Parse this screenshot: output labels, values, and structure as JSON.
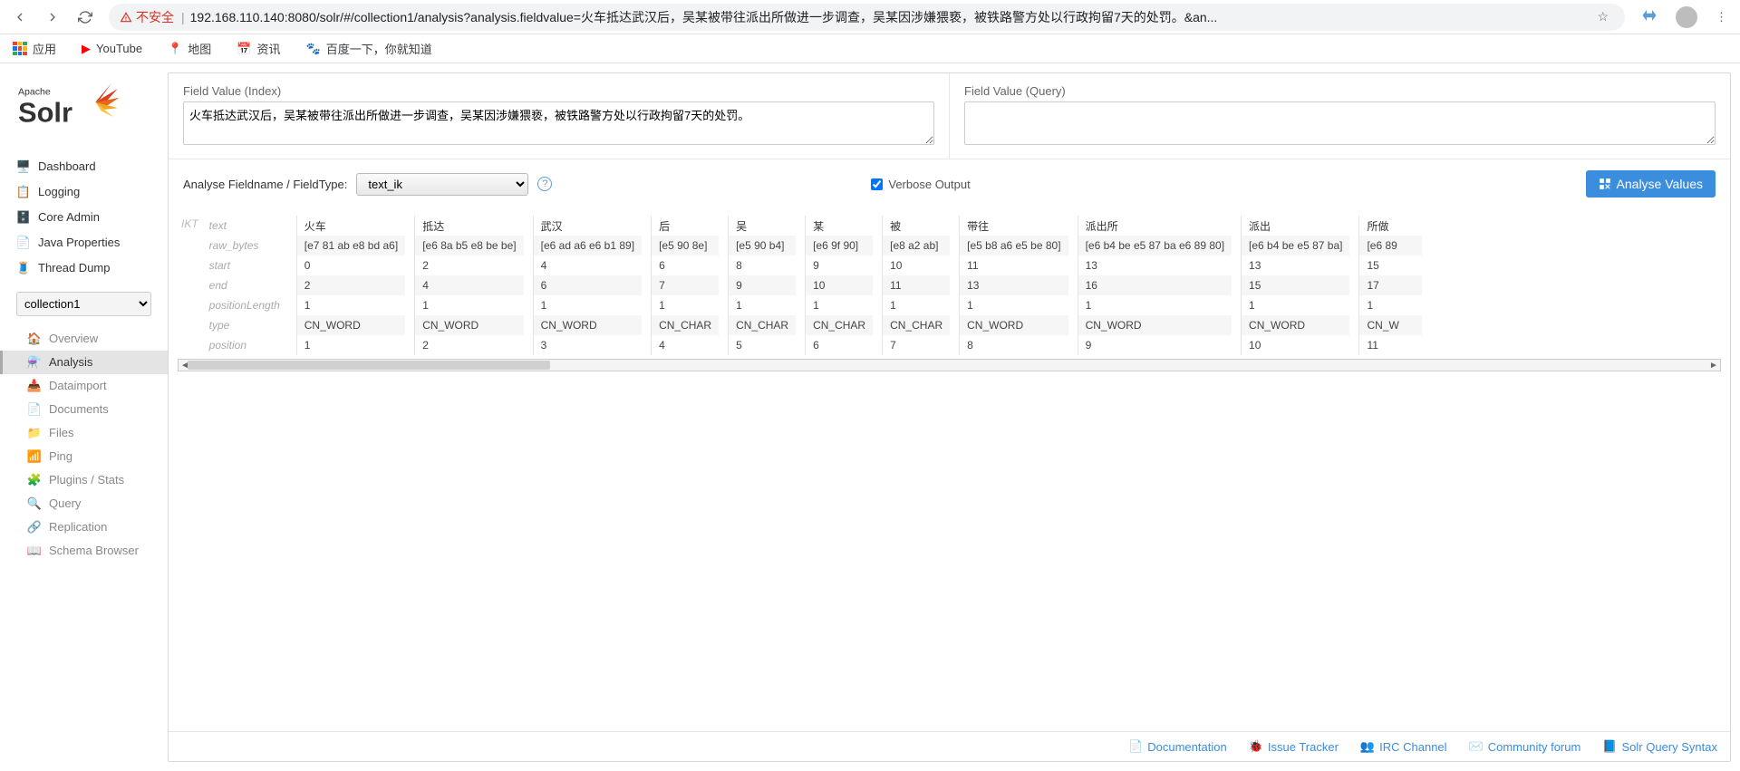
{
  "browser": {
    "insecure_label": "不安全",
    "url": "192.168.110.140:8080/solr/#/collection1/analysis?analysis.fieldvalue=火车抵达武汉后，吴某被带往派出所做进一步调查，吴某因涉嫌猥亵，被铁路警方处以行政拘留7天的处罚。&an..."
  },
  "bookmarks": {
    "apps": "应用",
    "items": [
      "YouTube",
      "地图",
      "资讯",
      "百度一下，你就知道"
    ]
  },
  "sidebar": {
    "logo_top": "Apache",
    "logo_main": "Solr",
    "items": [
      "Dashboard",
      "Logging",
      "Core Admin",
      "Java Properties",
      "Thread Dump"
    ],
    "collection_selected": "collection1",
    "sub": [
      "Overview",
      "Analysis",
      "Dataimport",
      "Documents",
      "Files",
      "Ping",
      "Plugins / Stats",
      "Query",
      "Replication",
      "Schema Browser"
    ]
  },
  "form": {
    "index_label": "Field Value (Index)",
    "index_value": "火车抵达武汉后，吴某被带往派出所做进一步调查，吴某因涉嫌猥亵，被铁路警方处以行政拘留7天的处罚。",
    "query_label": "Field Value (Query)",
    "query_value": "",
    "analyse_label": "Analyse Fieldname / FieldType:",
    "fieldtype_value": "text_ik",
    "verbose_label": "Verbose Output",
    "analyse_btn": "Analyse Values"
  },
  "analysis": {
    "tokenizer_label": "IKT",
    "row_labels": [
      "text",
      "raw_bytes",
      "start",
      "end",
      "positionLength",
      "type",
      "position"
    ],
    "columns": [
      {
        "text": "火车",
        "raw_bytes": "[e7 81 ab e8 bd a6]",
        "start": "0",
        "end": "2",
        "positionLength": "1",
        "type": "CN_WORD",
        "position": "1"
      },
      {
        "text": "抵达",
        "raw_bytes": "[e6 8a b5 e8 be be]",
        "start": "2",
        "end": "4",
        "positionLength": "1",
        "type": "CN_WORD",
        "position": "2"
      },
      {
        "text": "武汉",
        "raw_bytes": "[e6 ad a6 e6 b1 89]",
        "start": "4",
        "end": "6",
        "positionLength": "1",
        "type": "CN_WORD",
        "position": "3"
      },
      {
        "text": "后",
        "raw_bytes": "[e5 90 8e]",
        "start": "6",
        "end": "7",
        "positionLength": "1",
        "type": "CN_CHAR",
        "position": "4"
      },
      {
        "text": "吴",
        "raw_bytes": "[e5 90 b4]",
        "start": "8",
        "end": "9",
        "positionLength": "1",
        "type": "CN_CHAR",
        "position": "5"
      },
      {
        "text": "某",
        "raw_bytes": "[e6 9f 90]",
        "start": "9",
        "end": "10",
        "positionLength": "1",
        "type": "CN_CHAR",
        "position": "6"
      },
      {
        "text": "被",
        "raw_bytes": "[e8 a2 ab]",
        "start": "10",
        "end": "11",
        "positionLength": "1",
        "type": "CN_CHAR",
        "position": "7"
      },
      {
        "text": "带往",
        "raw_bytes": "[e5 b8 a6 e5 be 80]",
        "start": "11",
        "end": "13",
        "positionLength": "1",
        "type": "CN_WORD",
        "position": "8"
      },
      {
        "text": "派出所",
        "raw_bytes": "[e6 b4 be e5 87 ba e6 89 80]",
        "start": "13",
        "end": "16",
        "positionLength": "1",
        "type": "CN_WORD",
        "position": "9"
      },
      {
        "text": "派出",
        "raw_bytes": "[e6 b4 be e5 87 ba]",
        "start": "13",
        "end": "15",
        "positionLength": "1",
        "type": "CN_WORD",
        "position": "10"
      },
      {
        "text": "所做",
        "raw_bytes": "[e6 89",
        "start": "15",
        "end": "17",
        "positionLength": "1",
        "type": "CN_W",
        "position": "11"
      }
    ]
  },
  "footer": {
    "links": [
      "Documentation",
      "Issue Tracker",
      "IRC Channel",
      "Community forum",
      "Solr Query Syntax"
    ]
  }
}
